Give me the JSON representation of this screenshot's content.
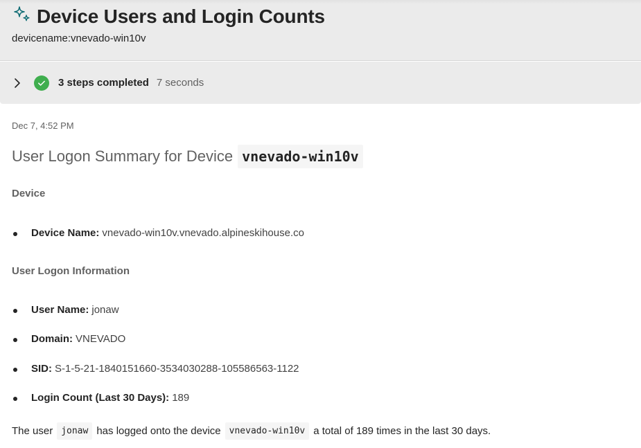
{
  "header": {
    "title": "Device Users and Login Counts",
    "subtitle": "devicename:vnevado-win10v",
    "icon": "sparkle-icon"
  },
  "steps": {
    "label": "3 steps completed",
    "duration": "7 seconds",
    "status_color": "#3fae4e"
  },
  "response": {
    "timestamp": "Dec 7, 4:52 PM",
    "heading_text": "User Logon Summary for Device",
    "heading_code": "vnevado-win10v",
    "device_section": {
      "label": "Device",
      "items": [
        {
          "key": "Device Name:",
          "value": "vnevado-win10v.vnevado.alpineskihouse.co"
        }
      ]
    },
    "logon_section": {
      "label": "User Logon Information",
      "items": [
        {
          "key": "User Name:",
          "value": "jonaw"
        },
        {
          "key": "Domain:",
          "value": "VNEVADO"
        },
        {
          "key": "SID:",
          "value": "S-1-5-21-1840151660-3534030288-105586563-1122"
        },
        {
          "key": "Login Count (Last 30 Days):",
          "value": "189"
        }
      ]
    },
    "summary": {
      "part1": "The user",
      "user_code": "jonaw",
      "part2": "has logged onto the device",
      "device_code": "vnevado-win10v",
      "part3": "a total of 189 times in the last 30 days."
    }
  }
}
